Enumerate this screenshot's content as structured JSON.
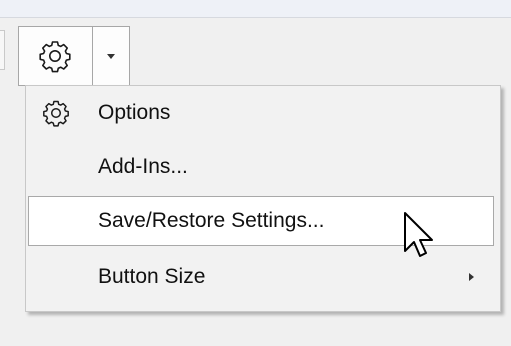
{
  "toolbar": {
    "gear_button": {
      "icon": "gear-icon"
    },
    "dropdown": {
      "icon": "chevron-down-icon"
    }
  },
  "menu": {
    "items": [
      {
        "label": "Options",
        "icon": "gear-icon",
        "highlighted": false,
        "has_submenu": false
      },
      {
        "label": "Add-Ins...",
        "icon": "",
        "highlighted": false,
        "has_submenu": false
      },
      {
        "label": "Save/Restore Settings...",
        "icon": "",
        "highlighted": true,
        "has_submenu": false
      },
      {
        "label": "Button Size",
        "icon": "",
        "highlighted": false,
        "has_submenu": true
      }
    ]
  },
  "colors": {
    "background": "#f0f0f0",
    "menu_background": "#f2f2f2",
    "highlight_background": "#ffffff",
    "highlight_border": "#a9a9a9",
    "text": "#111111"
  }
}
